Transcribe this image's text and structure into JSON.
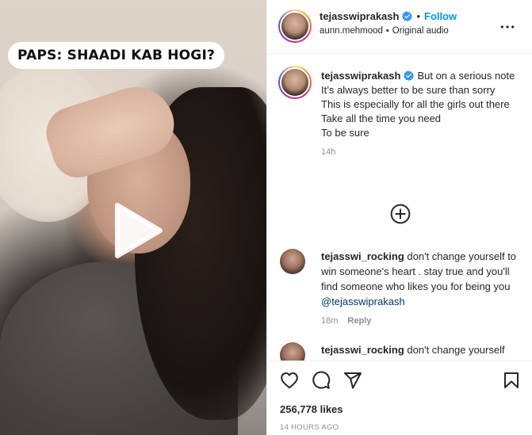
{
  "media": {
    "overlay_caption": "PAPS: SHAADI KAB HOGI?"
  },
  "header": {
    "username": "tejasswiprakash",
    "separator": "•",
    "follow_label": "Follow",
    "audio_user": "aunn.mehmood",
    "audio_separator": "•",
    "audio_label": "Original audio"
  },
  "caption": {
    "username": "tejasswiprakash",
    "lines": [
      "But on a serious note",
      "It’s always better to be sure than sorry",
      "This is especially for all the girls out there",
      "Take all the time you need",
      "To be sure"
    ],
    "time": "14h"
  },
  "comments": [
    {
      "username": "tejasswi_rocking",
      "text": "don't change yourself to win someone's heart . stay true and you'll find someone who likes you for being you",
      "mention": "@tejasswiprakash",
      "time": "18m",
      "reply_label": "Reply"
    },
    {
      "username": "tejasswi_rocking",
      "text": "don't change yourself",
      "mention": "",
      "time": "",
      "reply_label": ""
    }
  ],
  "footer": {
    "likes": "256,778 likes",
    "posted_ago": "14 HOURS AGO"
  },
  "colors": {
    "follow_blue": "#0095f6",
    "verified_blue": "#3897f0",
    "mention_blue": "#00376b",
    "secondary_gray": "#8e8e8e"
  },
  "icons": [
    "play-icon",
    "verified-icon",
    "more-icon",
    "add-circle-icon",
    "heart-icon",
    "comment-icon",
    "share-icon",
    "bookmark-icon"
  ]
}
